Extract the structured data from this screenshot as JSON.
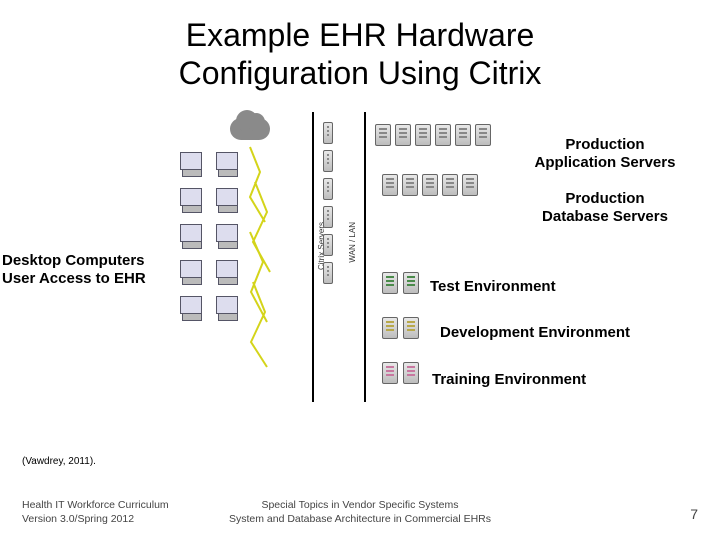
{
  "title_line1": "Example EHR Hardware",
  "title_line2": "Configuration Using Citrix",
  "labels": {
    "desktop_l1": "Desktop Computers",
    "desktop_l2": "User Access to EHR",
    "app_servers_l1": "Production",
    "app_servers_l2": "Application Servers",
    "db_servers_l1": "Production",
    "db_servers_l2": "Database Servers",
    "test": "Test Environment",
    "dev": "Development Environment",
    "train": "Training Environment"
  },
  "diagram_vlabels": {
    "citrix": "Citrix Servers",
    "wan": "WAN / LAN"
  },
  "citation": "(Vawdrey, 2011).",
  "footer": {
    "left_l1": "Health IT Workforce Curriculum",
    "left_l2": "Version 3.0/Spring 2012",
    "center_l1": "Special Topics in Vendor Specific Systems",
    "center_l2": "System and Database Architecture in Commercial EHRs",
    "page": "7"
  }
}
